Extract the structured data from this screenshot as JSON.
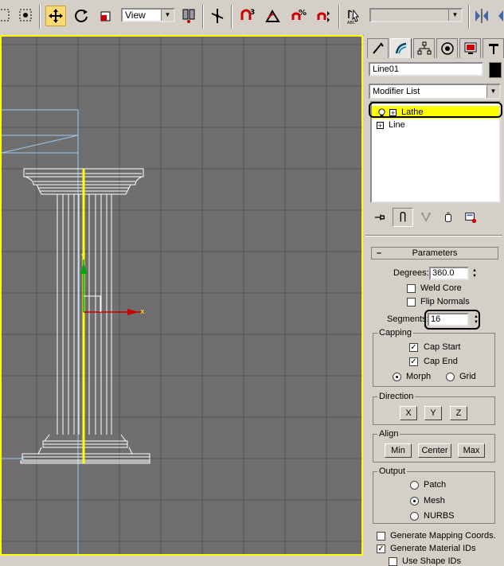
{
  "toolbar": {
    "view_select": "View",
    "named_selection_placeholder": ""
  },
  "panel": {
    "object_name": "Line01",
    "object_color": "#000000",
    "modifier_list": "Modifier List",
    "stack": [
      {
        "label": "Lathe",
        "selected": true
      },
      {
        "label": "Line",
        "selected": false
      }
    ],
    "rollout_title": "Parameters",
    "degrees_label": "Degrees:",
    "degrees_value": "360.0",
    "weld_core": "Weld Core",
    "flip_normals": "Flip Normals",
    "segments_label": "Segments:",
    "segments_value": "16",
    "capping_title": "Capping",
    "cap_start": "Cap Start",
    "cap_end": "Cap End",
    "morph": "Morph",
    "grid": "Grid",
    "direction_title": "Direction",
    "dir_x": "X",
    "dir_y": "Y",
    "dir_z": "Z",
    "align_title": "Align",
    "align_min": "Min",
    "align_center": "Center",
    "align_max": "Max",
    "output_title": "Output",
    "out_patch": "Patch",
    "out_mesh": "Mesh",
    "out_nurbs": "NURBS",
    "gen_mapping": "Generate Mapping Coords.",
    "gen_material": "Generate Material IDs",
    "use_shape": "Use Shape IDs"
  },
  "viewport": {
    "gizmo_x": "x",
    "gizmo_y": "y"
  },
  "colors": {
    "viewport_bg": "#6f6f6f",
    "active_border": "#ffff00",
    "selection": "#ffff00"
  }
}
